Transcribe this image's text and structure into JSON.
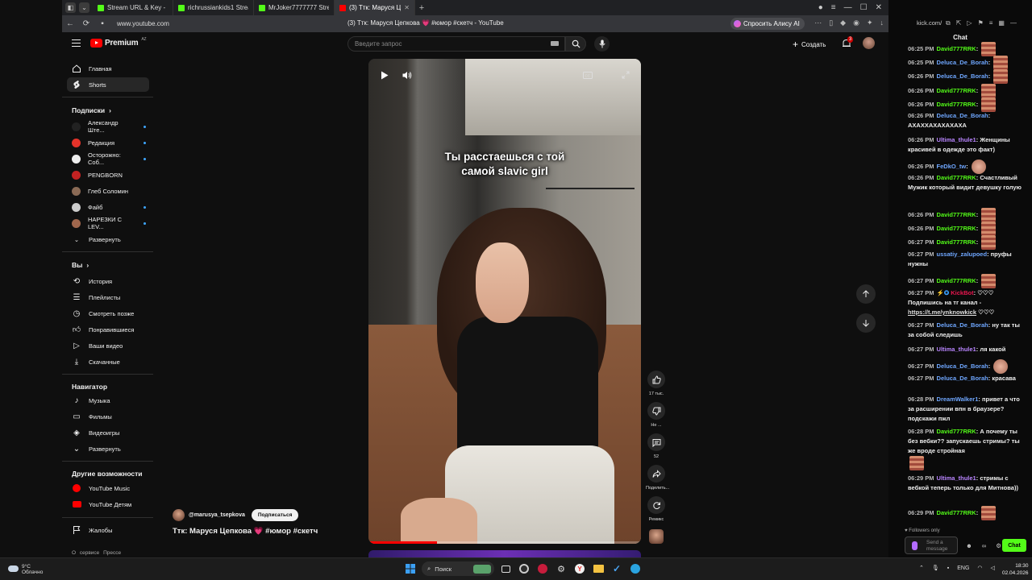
{
  "browser": {
    "tabs": [
      {
        "title": "Stream URL & Key - Kick",
        "color": "#53fc18"
      },
      {
        "title": "richrussiankids1 Stream",
        "color": "#53fc18"
      },
      {
        "title": "MrJoker7777777 Stream",
        "color": "#53fc18"
      },
      {
        "title": "(3) Tтк: Маруся Цепко",
        "color": "#ff0000"
      }
    ],
    "url": "www.youtube.com",
    "page_title": "(3) Tтк: Маруся Цепкова 💗 #юмор #скетч - YouTube",
    "alisa": "Спросить Алису AI"
  },
  "youtube": {
    "logo": "Premium",
    "logo_region": "AZ",
    "search_placeholder": "Введите запрос",
    "create": "Создать",
    "notif_count": "3",
    "sidebar": {
      "main": [
        {
          "label": "Главная",
          "icon": "home-icon"
        },
        {
          "label": "Shorts",
          "icon": "shorts-icon"
        }
      ],
      "subs_title": "Подписки",
      "subs": [
        {
          "label": "Александр Ште...",
          "color": "#222",
          "dot": true
        },
        {
          "label": "Редакция",
          "color": "#e4332a",
          "dot": true
        },
        {
          "label": "Осторожно: Соб...",
          "color": "#eee",
          "dot": true
        },
        {
          "label": "PENGBORN",
          "color": "#c32222",
          "dot": false
        },
        {
          "label": "Глеб Соломин",
          "color": "#8a6a55",
          "dot": false
        },
        {
          "label": "Файб",
          "color": "#ccc",
          "dot": true
        },
        {
          "label": "НАРЕЗКИ С LEV...",
          "color": "#a0674d",
          "dot": true
        }
      ],
      "expand": "Развернуть",
      "you_title": "Вы",
      "you": [
        {
          "label": "История",
          "icon": "history-icon"
        },
        {
          "label": "Плейлисты",
          "icon": "playlist-icon"
        },
        {
          "label": "Смотреть позже",
          "icon": "clock-icon"
        },
        {
          "label": "Понравившиеся",
          "icon": "like-icon"
        },
        {
          "label": "Ваши видео",
          "icon": "video-icon"
        },
        {
          "label": "Скачанные",
          "icon": "download-icon"
        }
      ],
      "nav_title": "Навигатор",
      "nav": [
        {
          "label": "Музыка",
          "icon": "music-icon"
        },
        {
          "label": "Фильмы",
          "icon": "film-icon"
        },
        {
          "label": "Видеоигры",
          "icon": "game-icon"
        },
        {
          "label": "Развернуть",
          "icon": "chevron-down-icon"
        }
      ],
      "more_title": "Другие возможности",
      "more": [
        {
          "label": "YouTube Music",
          "icon": "yt-music-icon"
        },
        {
          "label": "YouTube Детям",
          "icon": "yt-kids-icon"
        }
      ],
      "report": "Жалобы",
      "footer": "О сервисе Прессе"
    },
    "short": {
      "caption_line1": "Ты расстаешься с той",
      "caption_line2": "самой slavic girl",
      "channel": "@marusya_tsepkova",
      "subscribe": "Подписаться",
      "title": "Tтк: Маруся Цепкова",
      "title_heart": "💗",
      "title_tags": "#юмор #скетч",
      "likes": "17 тыс.",
      "dislike": "Не ...",
      "comments": "52",
      "share": "Поделить...",
      "remix": "Ремикс",
      "progress": 0.25
    }
  },
  "chat": {
    "channel_url": "kick.com/",
    "title": "Chat",
    "messages": [
      {
        "time": "06:25 PM",
        "user": "David777RRK",
        "color": "#53fc18",
        "text": "",
        "emote": true
      },
      {
        "time": "06:25 PM",
        "user": "Deluca_De_Borah",
        "color": "#6fa7ff",
        "text": "",
        "emote": true
      },
      {
        "time": "06:26 PM",
        "user": "Deluca_De_Borah",
        "color": "#6fa7ff",
        "text": "",
        "emote": true
      },
      {
        "time": "06:26 PM",
        "user": "David777RRK",
        "color": "#53fc18",
        "text": "",
        "emote": true
      },
      {
        "time": "06:26 PM",
        "user": "David777RRK",
        "color": "#53fc18",
        "text": "",
        "emote": true
      },
      {
        "time": "06:26 PM",
        "user": "Deluca_De_Borah",
        "color": "#6fa7ff",
        "text": "АХАХХАХАХАХАХА",
        "emote": false
      },
      {
        "time": "06:26 PM",
        "user": "Ultima_thule1",
        "color": "#b985ff",
        "text": "Женщины красивей в одежде это факт)",
        "emote": false
      },
      {
        "time": "06:26 PM",
        "user": "FeDkO_tw",
        "color": "#6fa7ff",
        "text": "",
        "emote": true
      },
      {
        "time": "06:26 PM",
        "user": "David777RRK",
        "color": "#53fc18",
        "text": "Счастливый Мужик который видит девушку голую",
        "emote": false
      },
      {
        "time": "06:26 PM",
        "user": "David777RRK",
        "color": "#53fc18",
        "text": "",
        "emote": true
      },
      {
        "time": "06:26 PM",
        "user": "David777RRK",
        "color": "#53fc18",
        "text": "",
        "emote": true
      },
      {
        "time": "06:27 PM",
        "user": "David777RRK",
        "color": "#53fc18",
        "text": "",
        "emote": true
      },
      {
        "time": "06:27 PM",
        "user": "ussatiy_zalupoed",
        "color": "#6fa7ff",
        "text": "пруфы нужны",
        "emote": false
      },
      {
        "time": "06:27 PM",
        "user": "David777RRK",
        "color": "#53fc18",
        "text": "",
        "emote": true
      },
      {
        "time": "06:27 PM",
        "user": "KickBot",
        "color": "#e9164f",
        "text": "♡♡♡ Подпишись на тг канал - ",
        "link": "https://t.me/ynknowkick",
        "tail": " ♡♡♡",
        "emote": false
      },
      {
        "time": "06:27 PM",
        "user": "Deluca_De_Borah",
        "color": "#6fa7ff",
        "text": "ну так ты за собой следишь",
        "emote": false
      },
      {
        "time": "06:27 PM",
        "user": "Ultima_thule1",
        "color": "#b985ff",
        "text": "ля какой",
        "emote": false
      },
      {
        "time": "06:27 PM",
        "user": "Deluca_De_Borah",
        "color": "#6fa7ff",
        "text": "",
        "emote": true
      },
      {
        "time": "06:27 PM",
        "user": "Deluca_De_Borah",
        "color": "#6fa7ff",
        "text": "красава",
        "emote": false
      },
      {
        "time": "06:28 PM",
        "user": "DreamWalker1",
        "color": "#6fa7ff",
        "text": "привет а что за расширении впн в браузере? подскажи пжл",
        "emote": false
      },
      {
        "time": "06:28 PM",
        "user": "David777RRK",
        "color": "#53fc18",
        "text": "А почему ты без вебки?? запускаешь стримы? ты же вроде стройная",
        "emote": true
      },
      {
        "time": "06:29 PM",
        "user": "Ultima_thule1",
        "color": "#b985ff",
        "text": "стримы с вебкой теперь только для Митнова))",
        "emote": false
      },
      {
        "time": "06:29 PM",
        "user": "David777RRK",
        "color": "#53fc18",
        "text": "",
        "emote": true
      }
    ],
    "followers_only": "Followers only",
    "input_placeholder": "Send a message",
    "send": "Chat"
  },
  "taskbar": {
    "temp": "9°C",
    "weather": "Облачно",
    "search": "Поиск",
    "lang": "ENG",
    "time": "18:30",
    "date": "02.04.2026"
  }
}
